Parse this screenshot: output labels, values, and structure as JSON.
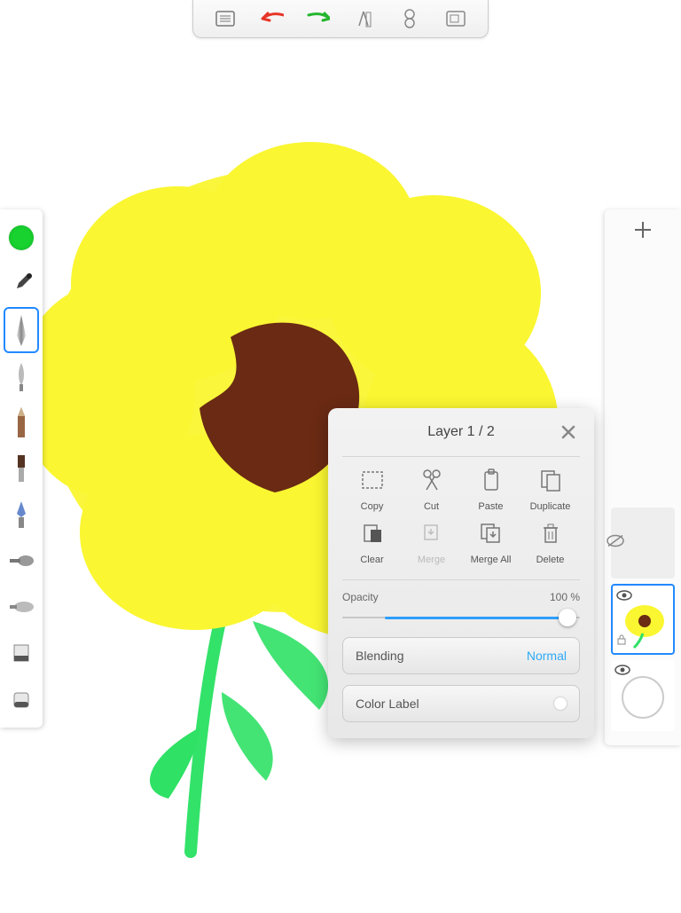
{
  "icons": {
    "list": "list-icon",
    "undo": "undo-icon",
    "redo": "redo-icon",
    "guide": "ruler-compass-icon",
    "symmetry": "symmetry-icon",
    "fullscreen": "fullscreen-icon",
    "eyedropper": "eyedropper-icon",
    "plus": "plus-icon",
    "eye": "eye-icon",
    "eye_off": "eye-off-icon"
  },
  "colors": {
    "current": "#18d22f",
    "undo_arrow": "#e63527",
    "redo_arrow": "#24b52e",
    "accent": "#2289ff"
  },
  "left_tools": [
    {
      "name": "color-swatch"
    },
    {
      "name": "eyedropper-tool"
    },
    {
      "name": "pen-tool",
      "selected": true
    },
    {
      "name": "brush-round-tool"
    },
    {
      "name": "pencil-tool"
    },
    {
      "name": "brush-flat-tool"
    },
    {
      "name": "marker-tool"
    },
    {
      "name": "airbrush-tool"
    },
    {
      "name": "smudge-tool"
    },
    {
      "name": "eraser-hard-tool"
    },
    {
      "name": "eraser-soft-tool"
    }
  ],
  "right_panel": {
    "add_label": "Add Layer",
    "layers": [
      {
        "name": "hidden-layer",
        "eye": false
      },
      {
        "name": "flower-layer",
        "eye": true,
        "selected": true,
        "locked": true
      },
      {
        "name": "background-layer",
        "eye": true
      }
    ]
  },
  "layer_modal": {
    "title": "Layer 1 / 2",
    "actions_row1": [
      {
        "key": "copy",
        "label": "Copy",
        "icon": "select-dashed-icon"
      },
      {
        "key": "cut",
        "label": "Cut",
        "icon": "scissors-icon"
      },
      {
        "key": "paste",
        "label": "Paste",
        "icon": "clipboard-icon"
      },
      {
        "key": "duplicate",
        "label": "Duplicate",
        "icon": "duplicate-icon"
      }
    ],
    "actions_row2": [
      {
        "key": "clear",
        "label": "Clear",
        "icon": "clear-icon"
      },
      {
        "key": "merge",
        "label": "Merge",
        "icon": "merge-down-icon",
        "disabled": true
      },
      {
        "key": "mergeall",
        "label": "Merge All",
        "icon": "merge-all-icon"
      },
      {
        "key": "delete",
        "label": "Delete",
        "icon": "trash-icon"
      }
    ],
    "opacity": {
      "label": "Opacity",
      "value": "100 %",
      "percent": 100
    },
    "blending": {
      "label": "Blending",
      "value": "Normal"
    },
    "color_label": {
      "label": "Color Label"
    }
  }
}
